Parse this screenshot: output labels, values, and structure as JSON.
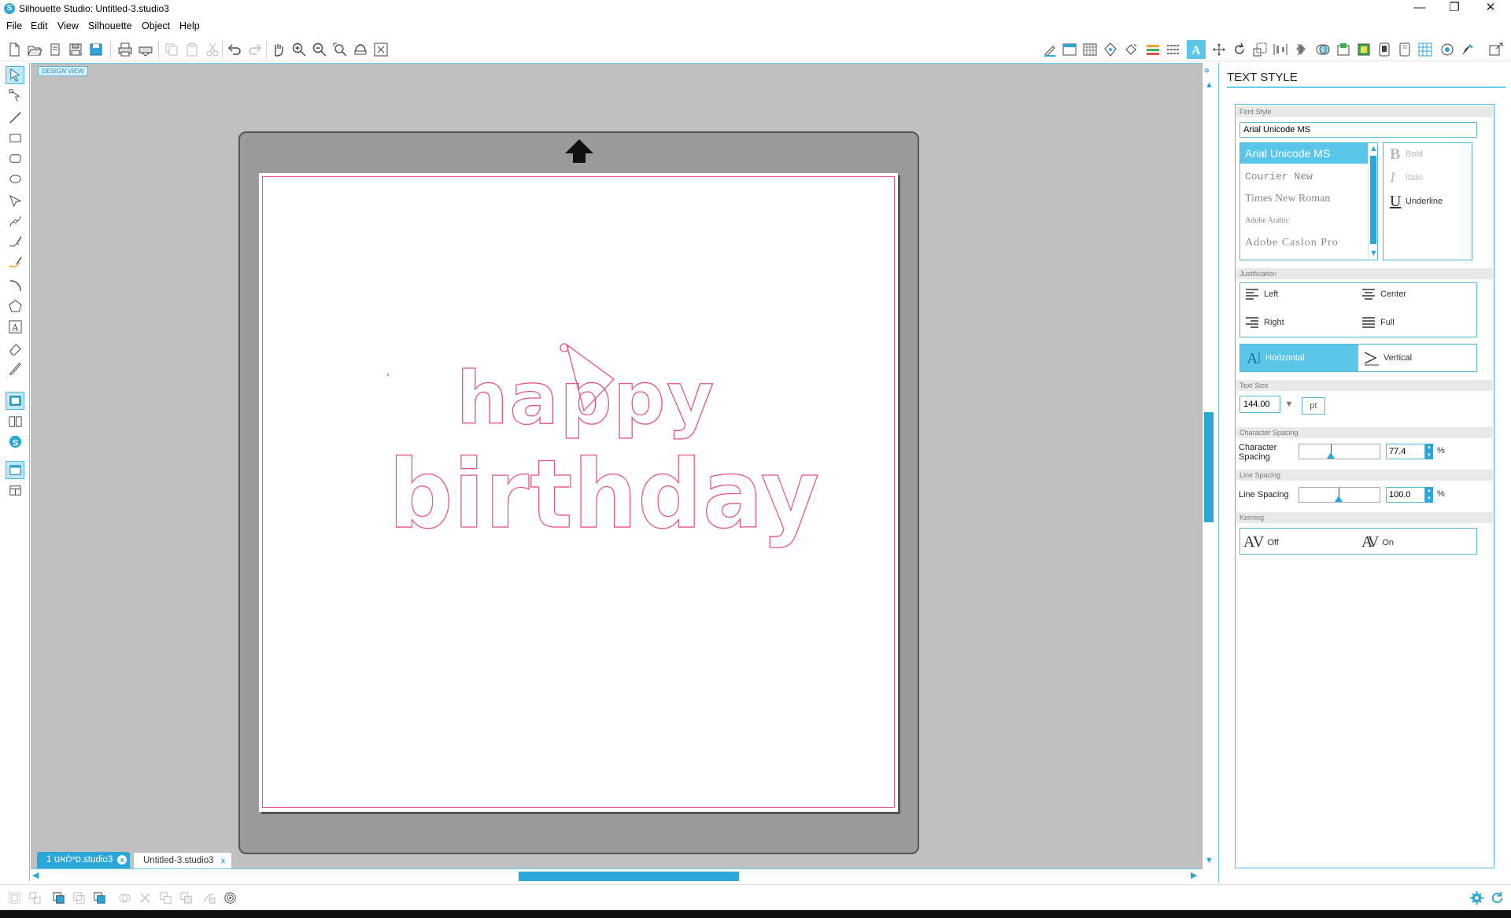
{
  "window": {
    "title": "Silhouette Studio: Untitled-3.studio3",
    "icon": "silhouette-logo",
    "minimize": "—",
    "restore": "❐",
    "close": "✕"
  },
  "menu": [
    "File",
    "Edit",
    "View",
    "Silhouette",
    "Object",
    "Help"
  ],
  "toolbar": {
    "left_icons": [
      "new-document-icon",
      "open-icon",
      "library-icon",
      "save-icon",
      "save-to-library-icon",
      "print-icon",
      "print-cut-icon",
      "copy-icon",
      "paste-icon",
      "cut-icon",
      "undo-icon",
      "redo-icon",
      "pan-icon",
      "zoom-in-icon",
      "zoom-out-icon",
      "zoom-box-icon",
      "drag-zoom-icon",
      "fit-to-page-icon"
    ],
    "right_icons": [
      "page-setup-icon",
      "grid-icon",
      "registration-icon",
      "store-icon",
      "fill-color-icon",
      "line-color-icon",
      "line-style-icon",
      "text-style-icon",
      "transform-icon",
      "rotate-icon",
      "scale-icon",
      "align-icon",
      "replicate-icon",
      "modify-icon",
      "offset-icon",
      "trace-icon",
      "pixscan-icon",
      "image-effects-icon",
      "grid-layout-icon",
      "send-to-silhouette-icon",
      "send-icon"
    ],
    "active": "text-style-icon"
  },
  "left_tools": [
    "select-tool-icon",
    "point-edit-icon",
    "line-tool-icon",
    "rectangle-tool-icon",
    "rounded-rectangle-icon",
    "ellipse-tool-icon",
    "polygon-tool-icon",
    "curve-tool-icon",
    "freehand-tool-icon",
    "smooth-freehand-icon",
    "arc-tool-icon",
    "regular-polygon-icon",
    "text-tool-icon",
    "eraser-tool-icon",
    "knife-tool-icon",
    "design-view-icon",
    "library-view-icon",
    "store-view-icon",
    "single-view-icon",
    "split-view-icon"
  ],
  "canvas": {
    "view_label": "DESIGN VIEW",
    "design_text_line1": "happy",
    "design_text_line2": "birthday",
    "outline_color": "#e9547d"
  },
  "tabs": [
    {
      "label": "1 סילואט.studio3",
      "active": true,
      "close": "x"
    },
    {
      "label": "Untitled-3.studio3",
      "active": false,
      "close": "x"
    }
  ],
  "panel": {
    "title": "TEXT STYLE",
    "font_style_label": "Font Style",
    "font_search_value": "Arial Unicode MS",
    "fonts": [
      "Arial Unicode MS",
      "Courier New",
      "Times New Roman",
      "Adobe Arabic",
      "Adobe Caslon Pro"
    ],
    "selected_font": "Arial Unicode MS",
    "styles": [
      {
        "glyph": "B",
        "label": "Bold",
        "enabled": false
      },
      {
        "glyph": "I",
        "label": "Italic",
        "enabled": false
      },
      {
        "glyph": "U",
        "label": "Underline",
        "enabled": true
      }
    ],
    "justification_label": "Justification",
    "justification": {
      "left": "Left",
      "center": "Center",
      "right": "Right",
      "full": "Full"
    },
    "orientation": {
      "horizontal": "Horizontal",
      "vertical": "Vertical",
      "active": "Horizontal"
    },
    "text_size_label": "Text Size",
    "text_size_value": "144.00",
    "text_size_unit": "pt",
    "char_spacing_section": "Character Spacing",
    "char_spacing_label_1": "Character",
    "char_spacing_label_2": "Spacing",
    "char_spacing_value": "77.4",
    "line_spacing_section": "Line Spacing",
    "line_spacing_label": "Line Spacing",
    "line_spacing_value": "100.0",
    "percent": "%",
    "kerning_label": "Kerning",
    "kerning_off": "Off",
    "kerning_on": "On",
    "kerning_glyph": "AV"
  },
  "bottom_icons": [
    "group-icon",
    "ungroup-icon",
    "compound-path-icon",
    "release-compound-icon",
    "bring-to-front-icon",
    "weld-icon",
    "delete-icon",
    "duplicate-icon",
    "mirror-icon",
    "fill-pattern-icon",
    "offset-quick-icon"
  ],
  "status_icons": [
    "settings-gear-icon",
    "refresh-icon"
  ]
}
